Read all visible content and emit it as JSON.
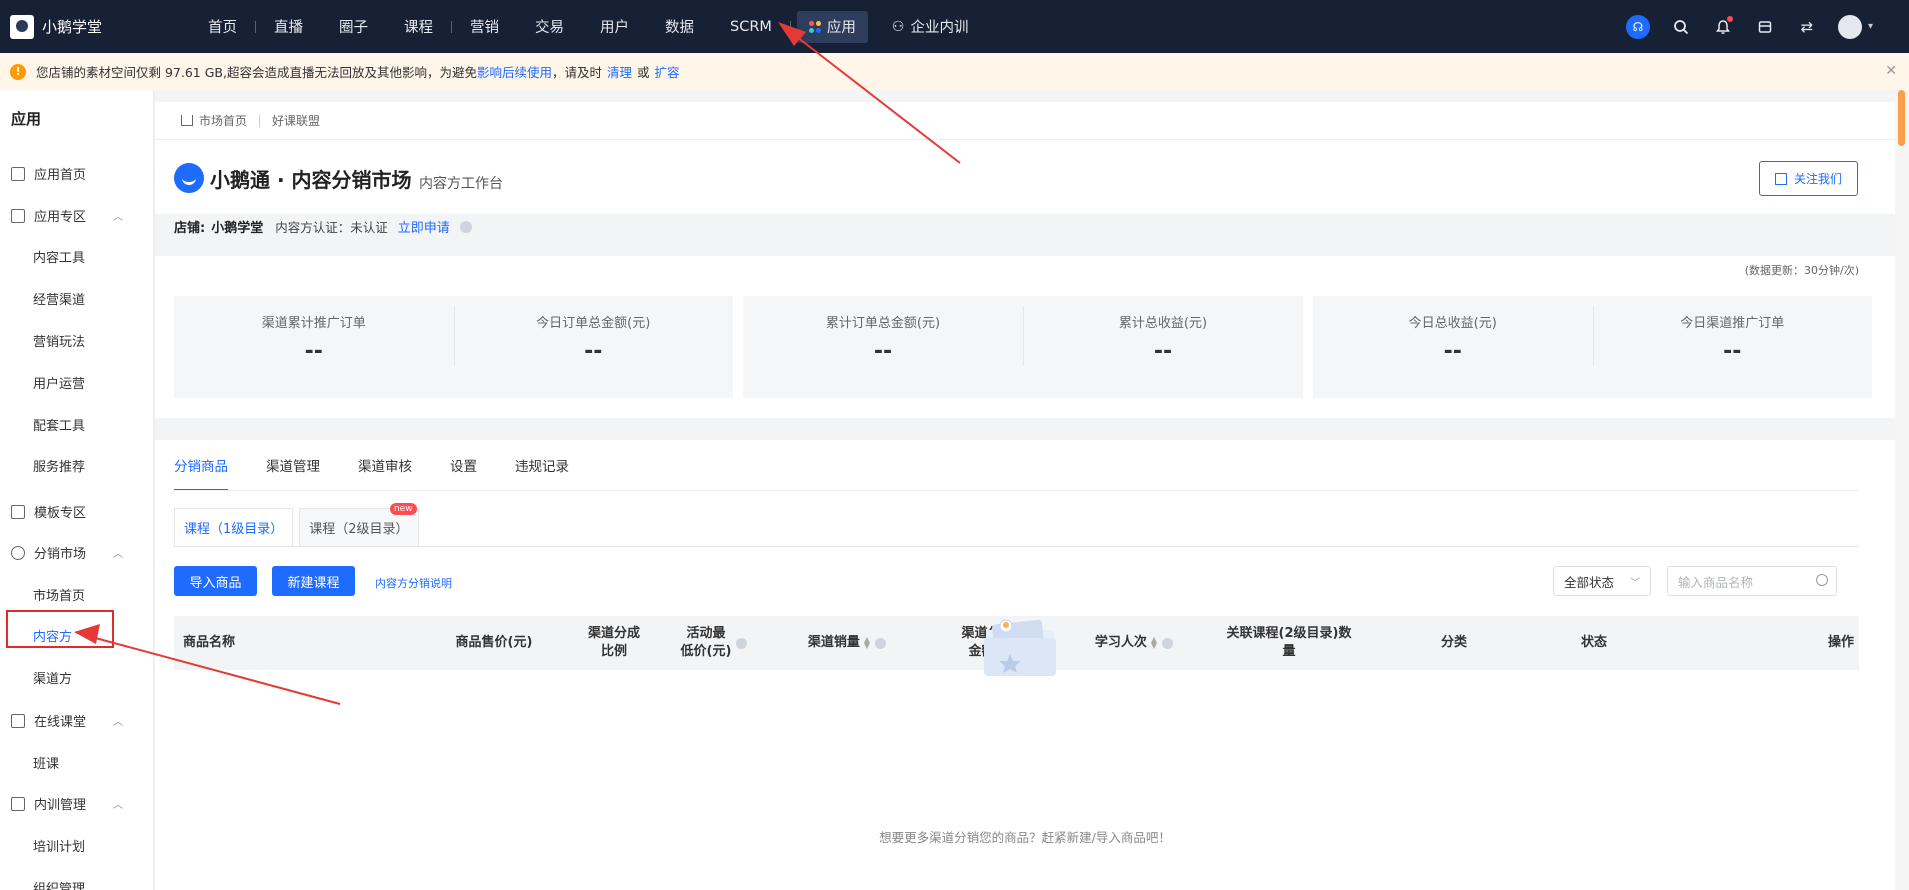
{
  "topnav": {
    "brand": "小鹅学堂",
    "items": [
      "首页",
      "直播",
      "圈子",
      "课程",
      "营销",
      "交易",
      "用户",
      "数据",
      "SCRM"
    ],
    "active_item": "应用",
    "train_item": "企业内训"
  },
  "alert": {
    "text_before": "您店铺的素材空间仅剩 97.61 GB,超容会造成直播无法回放及其他影响，为避免",
    "link_impact": "影响后续使用",
    "text_mid": "，请及时",
    "link_clean": "清理",
    "text_or": "或",
    "link_expand": "扩容"
  },
  "sidebar": {
    "title": "应用",
    "items": [
      {
        "label": "应用首页",
        "type": "group"
      },
      {
        "label": "应用专区",
        "type": "group"
      },
      {
        "label": "内容工具",
        "type": "sub"
      },
      {
        "label": "经营渠道",
        "type": "sub"
      },
      {
        "label": "营销玩法",
        "type": "sub"
      },
      {
        "label": "用户运营",
        "type": "sub"
      },
      {
        "label": "配套工具",
        "type": "sub"
      },
      {
        "label": "服务推荐",
        "type": "sub"
      },
      {
        "label": "模板专区",
        "type": "group"
      },
      {
        "label": "分销市场",
        "type": "group"
      },
      {
        "label": "市场首页",
        "type": "sub"
      },
      {
        "label": "内容方",
        "type": "sub"
      },
      {
        "label": "渠道方",
        "type": "sub"
      },
      {
        "label": "在线课堂",
        "type": "group"
      },
      {
        "label": "班课",
        "type": "sub"
      },
      {
        "label": "内训管理",
        "type": "group"
      },
      {
        "label": "培训计划",
        "type": "sub"
      },
      {
        "label": "组织管理",
        "type": "sub"
      }
    ]
  },
  "breadcrumb": [
    "市场首页",
    "好课联盟"
  ],
  "header": {
    "title": "小鹅通 · 内容分销市场",
    "subtitle": "内容方工作台",
    "follow_button": "关注我们"
  },
  "shop": {
    "label": "店铺:",
    "name": "小鹅学堂",
    "cert": "内容方认证：未认证",
    "apply_link": "立即申请"
  },
  "stats": {
    "update_note": "(数据更新：30分钟/次)",
    "items": [
      {
        "label": "渠道累计推广订单",
        "value": "--"
      },
      {
        "label": "今日订单总金额(元)",
        "value": "--"
      },
      {
        "label": "累计订单总金额(元)",
        "value": "--"
      },
      {
        "label": "累计总收益(元)",
        "value": "--"
      },
      {
        "label": "今日总收益(元)",
        "value": "--"
      },
      {
        "label": "今日渠道推广订单",
        "value": "--"
      }
    ]
  },
  "tabs": [
    "分销商品",
    "渠道管理",
    "渠道审核",
    "设置",
    "违规记录"
  ],
  "subtabs": {
    "first": "课程（1级目录）",
    "second": "课程（2级目录）",
    "badge": "new"
  },
  "actions": {
    "import": "导入商品",
    "create": "新建课程",
    "guide": "内容方分销说明",
    "status_select": "全部状态",
    "search_placeholder": "输入商品名称"
  },
  "table_headers": {
    "name": "商品名称",
    "price": "商品售价(元)",
    "ratio_1": "渠道分成",
    "ratio_2": "比例",
    "min_price_1": "活动最",
    "min_price_2": "低价(元)",
    "sales": "渠道销量",
    "total_1": "渠道分成总",
    "total_2": "金额(元)",
    "learners": "学习人次",
    "linked_1": "关联课程(2级目录)数",
    "linked_2": "量",
    "category": "分类",
    "status": "状态",
    "ops": "操作"
  },
  "empty_text": "想要更多渠道分销您的商品？赶紧新建/导入商品吧！",
  "colors": {
    "nav_bg": "#172135",
    "primary": "#1e6bff",
    "alert_bg": "#fff5e8",
    "highlight_red": "#e02b2b"
  }
}
